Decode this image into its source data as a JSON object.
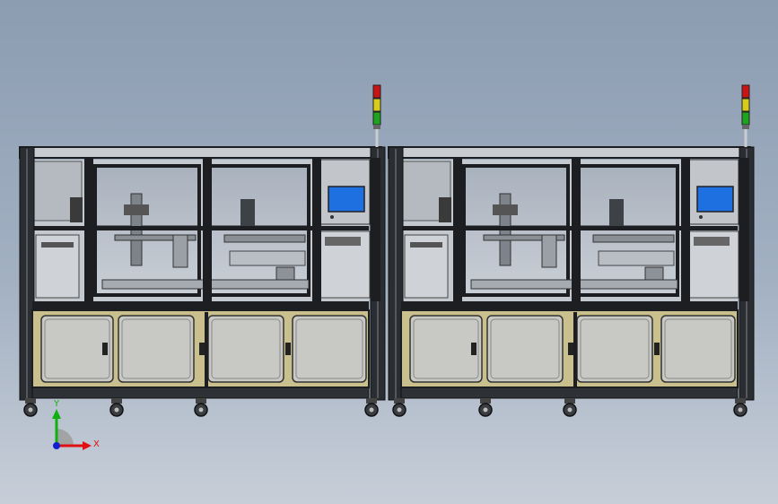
{
  "viewport": {
    "background_top": "#8c9cb1",
    "background_bottom": "#c7ced8"
  },
  "machine": {
    "modules": 2,
    "frame_color": "#1c1e21",
    "cabinet_panel_color": "#c9c08d",
    "door_color": "#c8c8c5",
    "window_color": "#b7bdc6",
    "hmi_screen_color": "#1e6fe0",
    "signal_tower": {
      "colors": [
        "#c81414",
        "#d8cc1a",
        "#1da31d"
      ]
    }
  },
  "axis_triad": {
    "x_label": "X",
    "y_label": "Y",
    "x_color": "#e01010",
    "y_color": "#10b010",
    "z_color": "#1020d0"
  }
}
